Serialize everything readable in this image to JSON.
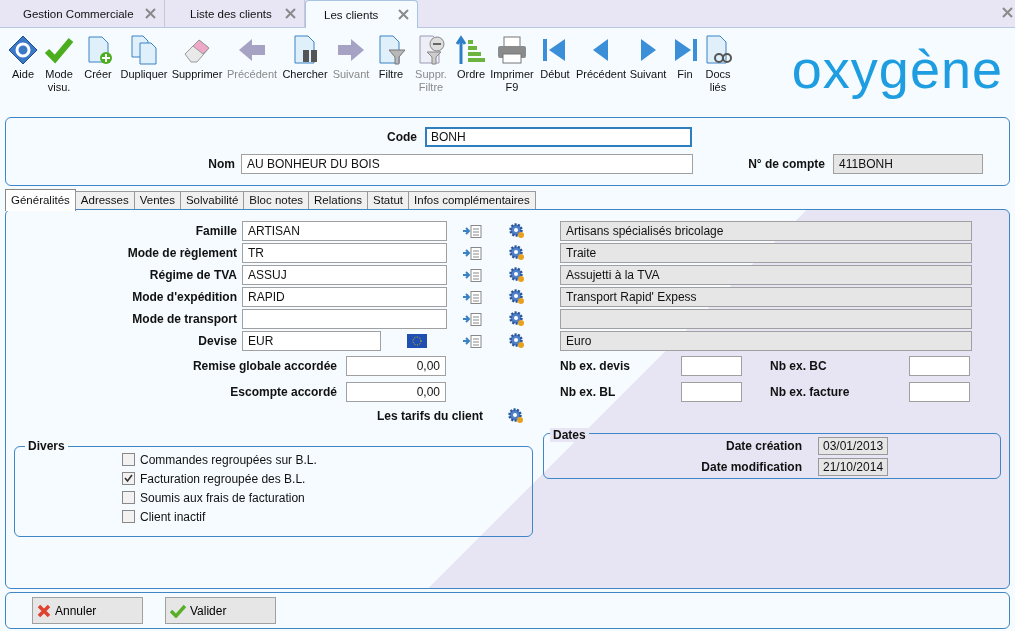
{
  "window_tabs": [
    {
      "label": "Gestion Commerciale",
      "selected": false
    },
    {
      "label": "Liste des clients",
      "selected": false
    },
    {
      "label": "Les clients",
      "selected": true
    }
  ],
  "toolbar": [
    {
      "label": "Aide",
      "disabled": false
    },
    {
      "label": "Mode visu.",
      "disabled": false
    },
    {
      "label": "Créer",
      "disabled": false
    },
    {
      "label": "Dupliquer",
      "disabled": false
    },
    {
      "label": "Supprimer",
      "disabled": false
    },
    {
      "label": "Précédent",
      "disabled": true
    },
    {
      "label": "Chercher",
      "disabled": false
    },
    {
      "label": "Suivant",
      "disabled": true
    },
    {
      "label": "Filtre",
      "disabled": false
    },
    {
      "label": "Suppr. Filtre",
      "disabled": true
    },
    {
      "label": "Ordre",
      "disabled": false
    },
    {
      "label": "Imprimer F9",
      "disabled": false
    },
    {
      "label": "Début",
      "disabled": false
    },
    {
      "label": "Précédent",
      "disabled": false
    },
    {
      "label": "Suivant",
      "disabled": false
    },
    {
      "label": "Fin",
      "disabled": false
    },
    {
      "label": "Docs liés",
      "disabled": false
    }
  ],
  "logo": "oxygène",
  "header": {
    "code": {
      "label": "Code",
      "value": "BONH"
    },
    "nom": {
      "label": "Nom",
      "value": "AU BONHEUR DU BOIS"
    },
    "compte": {
      "label": "N° de compte",
      "value": "411BONH"
    }
  },
  "tabs": [
    {
      "label": "Généralités",
      "selected": true
    },
    {
      "label": "Adresses",
      "selected": false
    },
    {
      "label": "Ventes",
      "selected": false
    },
    {
      "label": "Solvabilité",
      "selected": false
    },
    {
      "label": "Bloc notes",
      "selected": false
    },
    {
      "label": "Relations",
      "selected": false
    },
    {
      "label": "Statut",
      "selected": false
    },
    {
      "label": "Infos complémentaires",
      "selected": false
    }
  ],
  "fields": [
    {
      "kind": "code",
      "label": "Famille",
      "value": "ARTISAN",
      "description": "Artisans spécialisés bricolage"
    },
    {
      "kind": "code",
      "label": "Mode de règlement",
      "value": "TR",
      "description": "Traite"
    },
    {
      "kind": "code",
      "label": "Régime de TVA",
      "value": "ASSUJ",
      "description": "Assujetti à la TVA"
    },
    {
      "kind": "code",
      "label": "Mode d'expédition",
      "value": "RAPID",
      "description": "Transport Rapid' Expess"
    },
    {
      "kind": "code",
      "label": "Mode de transport"
    },
    {
      "kind": "currency",
      "label": "Devise",
      "value": "EUR",
      "description": "Euro"
    }
  ],
  "amounts": [
    {
      "label": "Remise globale accordée",
      "value": "0,00"
    },
    {
      "label": "Escompte accordé",
      "value": "0,00"
    }
  ],
  "counts": [
    {
      "label": "Nb ex. devis"
    },
    {
      "label": "Nb ex. BC"
    },
    {
      "label": "Nb ex. BL"
    },
    {
      "label": "Nb ex. facture"
    }
  ],
  "tarifs_label": "Les tarifs du client",
  "divers": {
    "title": "Divers",
    "options": [
      {
        "label": "Commandes regroupées sur B.L.",
        "checked": false
      },
      {
        "label": "Facturation regroupée des B.L.",
        "checked": true
      },
      {
        "label": "Soumis aux frais de facturation",
        "checked": false
      },
      {
        "label": "Client inactif",
        "checked": false
      }
    ]
  },
  "dates": {
    "title": "Dates",
    "rows": [
      {
        "label": "Date création",
        "value": "03/01/2013"
      },
      {
        "label": "Date modification",
        "value": "21/10/2014"
      }
    ]
  },
  "buttons": [
    {
      "kind": "cancel",
      "label": "Annuler"
    },
    {
      "kind": "ok",
      "label": "Valider"
    }
  ]
}
